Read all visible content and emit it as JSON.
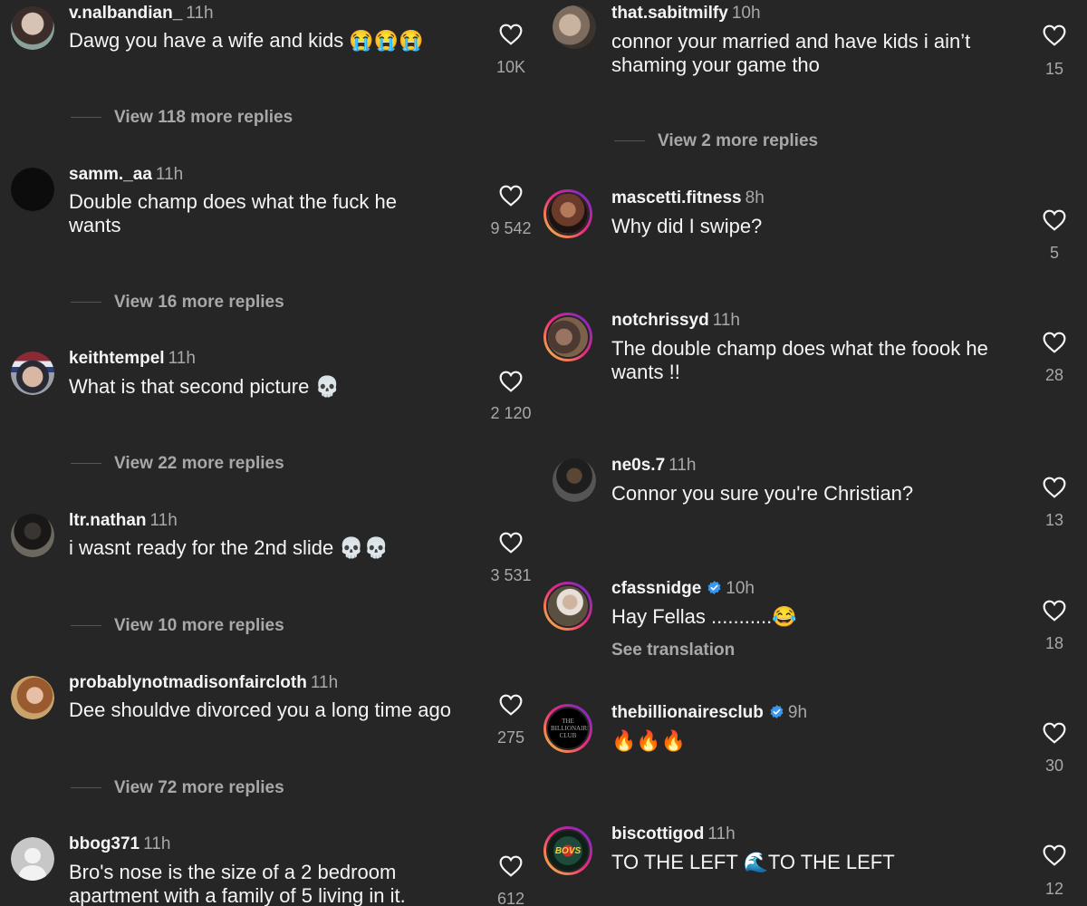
{
  "left_column": [
    {
      "username": "v.nalbandian_",
      "time": "11h",
      "text": "Dawg you have a wife and kids 😭😭😭",
      "likes": "10K",
      "replies": "View 118 more replies"
    },
    {
      "username": "samm._aa",
      "time": "11h",
      "text": "Double champ does what the fuck he wants",
      "likes": "9 542",
      "replies": "View 16 more replies"
    },
    {
      "username": "keithtempel",
      "time": "11h",
      "text": "What is that second picture 💀",
      "likes": "2 120",
      "replies": "View 22 more replies"
    },
    {
      "username": "ltr.nathan",
      "time": "11h",
      "text": "i wasnt ready for the 2nd slide 💀💀",
      "likes": "3 531",
      "replies": "View 10 more replies"
    },
    {
      "username": "probablynotmadisonfaircloth",
      "time": "11h",
      "text": "Dee shouldve divorced you a long time ago",
      "likes": "275",
      "replies": "View 72 more replies"
    },
    {
      "username": "bbog371",
      "time": "11h",
      "text": "Bro's nose is the size of a 2 bedroom apartment with a family of 5 living in it.",
      "likes": "612"
    }
  ],
  "right_column": [
    {
      "username": "that.sabitmilfy",
      "time": "10h",
      "text": "connor your married and have kids i ain’t shaming your game tho",
      "likes": "15",
      "replies": "View 2 more replies"
    },
    {
      "username": "mascetti.fitness",
      "time": "8h",
      "text": "Why did I swipe?",
      "likes": "5"
    },
    {
      "username": "notchrissyd",
      "time": "11h",
      "text": "The double champ does what the foook he wants !!",
      "likes": "28"
    },
    {
      "username": "ne0s.7",
      "time": "11h",
      "text": "Connor you sure you're Christian?",
      "likes": "13"
    },
    {
      "username": "cfassnidge",
      "time": "10h",
      "verified": true,
      "text": "Hay Fellas ...........😂",
      "see_translation": "See translation",
      "likes": "18"
    },
    {
      "username": "thebillionairesclub",
      "time": "9h",
      "verified": true,
      "text": "🔥🔥🔥",
      "likes": "30",
      "avatar_text": "THE BILLIONAIRES CLUB"
    },
    {
      "username": "biscottigod",
      "time": "11h",
      "text": "TO THE LEFT 🌊TO THE LEFT",
      "likes": "12",
      "avatar_text": "BOVS"
    }
  ],
  "colors": {
    "background": "#262626",
    "primary_text": "#f5f5f5",
    "secondary_text": "#a8a8a8",
    "verified_blue": "#3897f0",
    "story_ring": [
      "#f9ce34",
      "#ee2a7b",
      "#6228d7"
    ]
  },
  "icons": {
    "like": "heart-outline-icon",
    "verified": "verified-badge-icon",
    "default_avatar": "default-avatar-icon"
  }
}
